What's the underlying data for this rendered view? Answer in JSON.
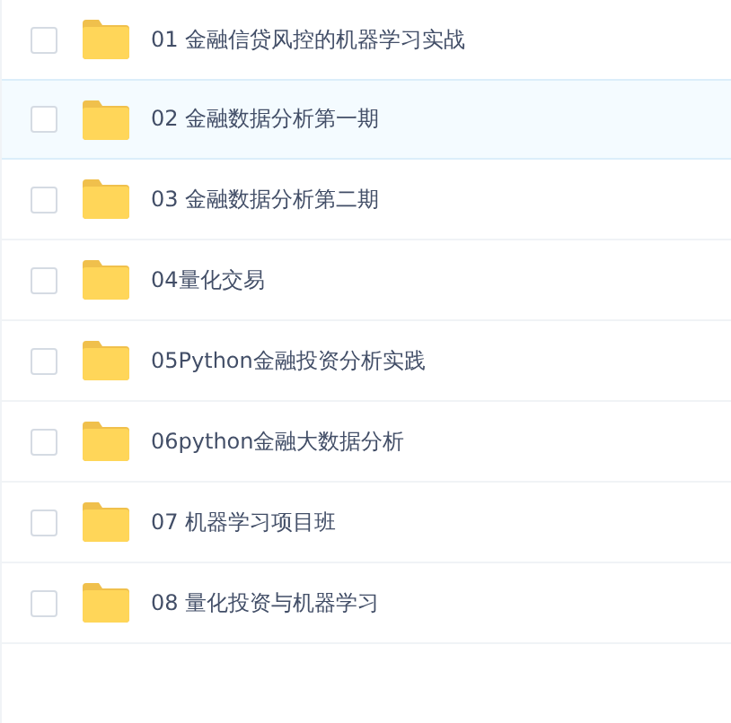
{
  "files": [
    {
      "name": "01 金融信贷风控的机器学习实战",
      "checked": false,
      "selected": false
    },
    {
      "name": "02 金融数据分析第一期",
      "checked": false,
      "selected": true
    },
    {
      "name": "03 金融数据分析第二期",
      "checked": false,
      "selected": false
    },
    {
      "name": "04量化交易",
      "checked": false,
      "selected": false
    },
    {
      "name": "05Python金融投资分析实践",
      "checked": false,
      "selected": false
    },
    {
      "name": "06python金融大数据分析",
      "checked": false,
      "selected": false
    },
    {
      "name": "07 机器学习项目班",
      "checked": false,
      "selected": false
    },
    {
      "name": "08 量化投资与机器学习",
      "checked": false,
      "selected": false
    }
  ]
}
